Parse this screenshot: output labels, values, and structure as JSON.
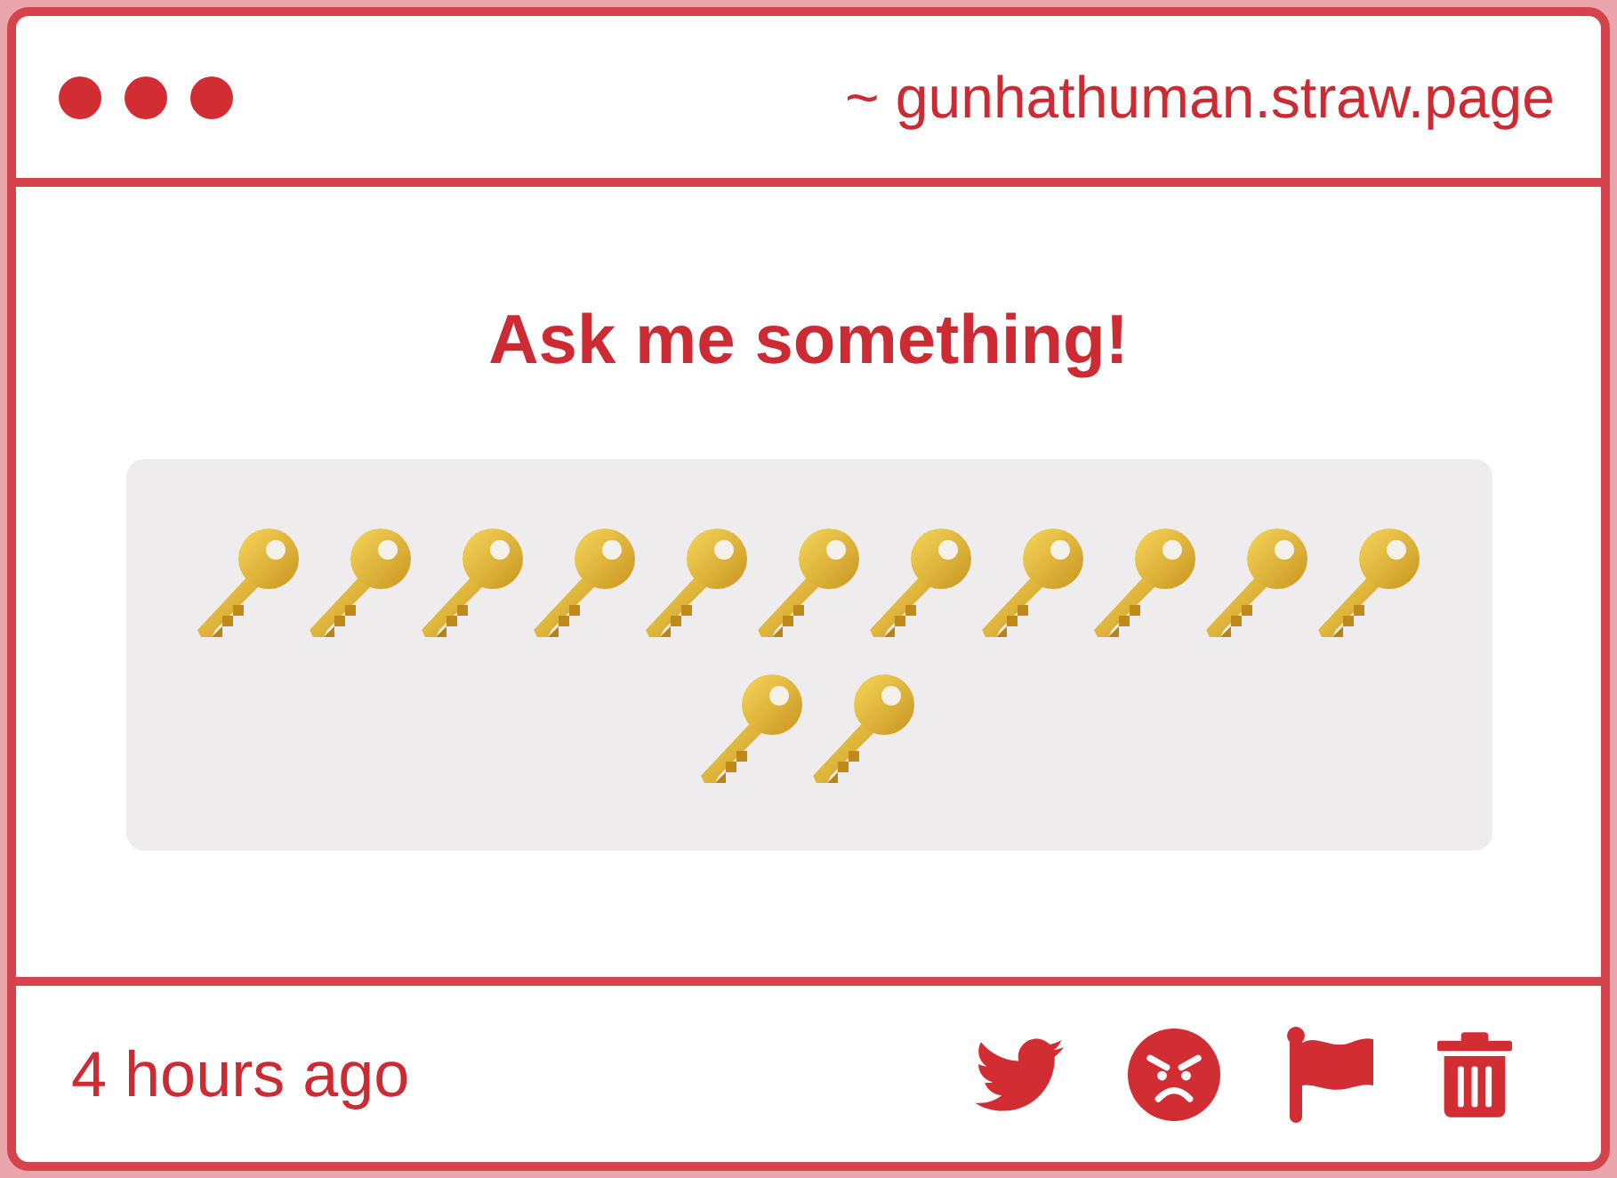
{
  "header": {
    "url": "~ gunhathuman.straw.page"
  },
  "question": {
    "title": "Ask me something!",
    "emoji": [
      {
        "kind": "key"
      },
      {
        "kind": "key"
      },
      {
        "kind": "key"
      },
      {
        "kind": "key"
      },
      {
        "kind": "key"
      },
      {
        "kind": "key"
      },
      {
        "kind": "key"
      },
      {
        "kind": "key"
      },
      {
        "kind": "key"
      },
      {
        "kind": "key"
      },
      {
        "kind": "key"
      },
      {
        "kind": "key"
      },
      {
        "kind": "key"
      }
    ]
  },
  "footer": {
    "time": "4 hours ago"
  }
}
